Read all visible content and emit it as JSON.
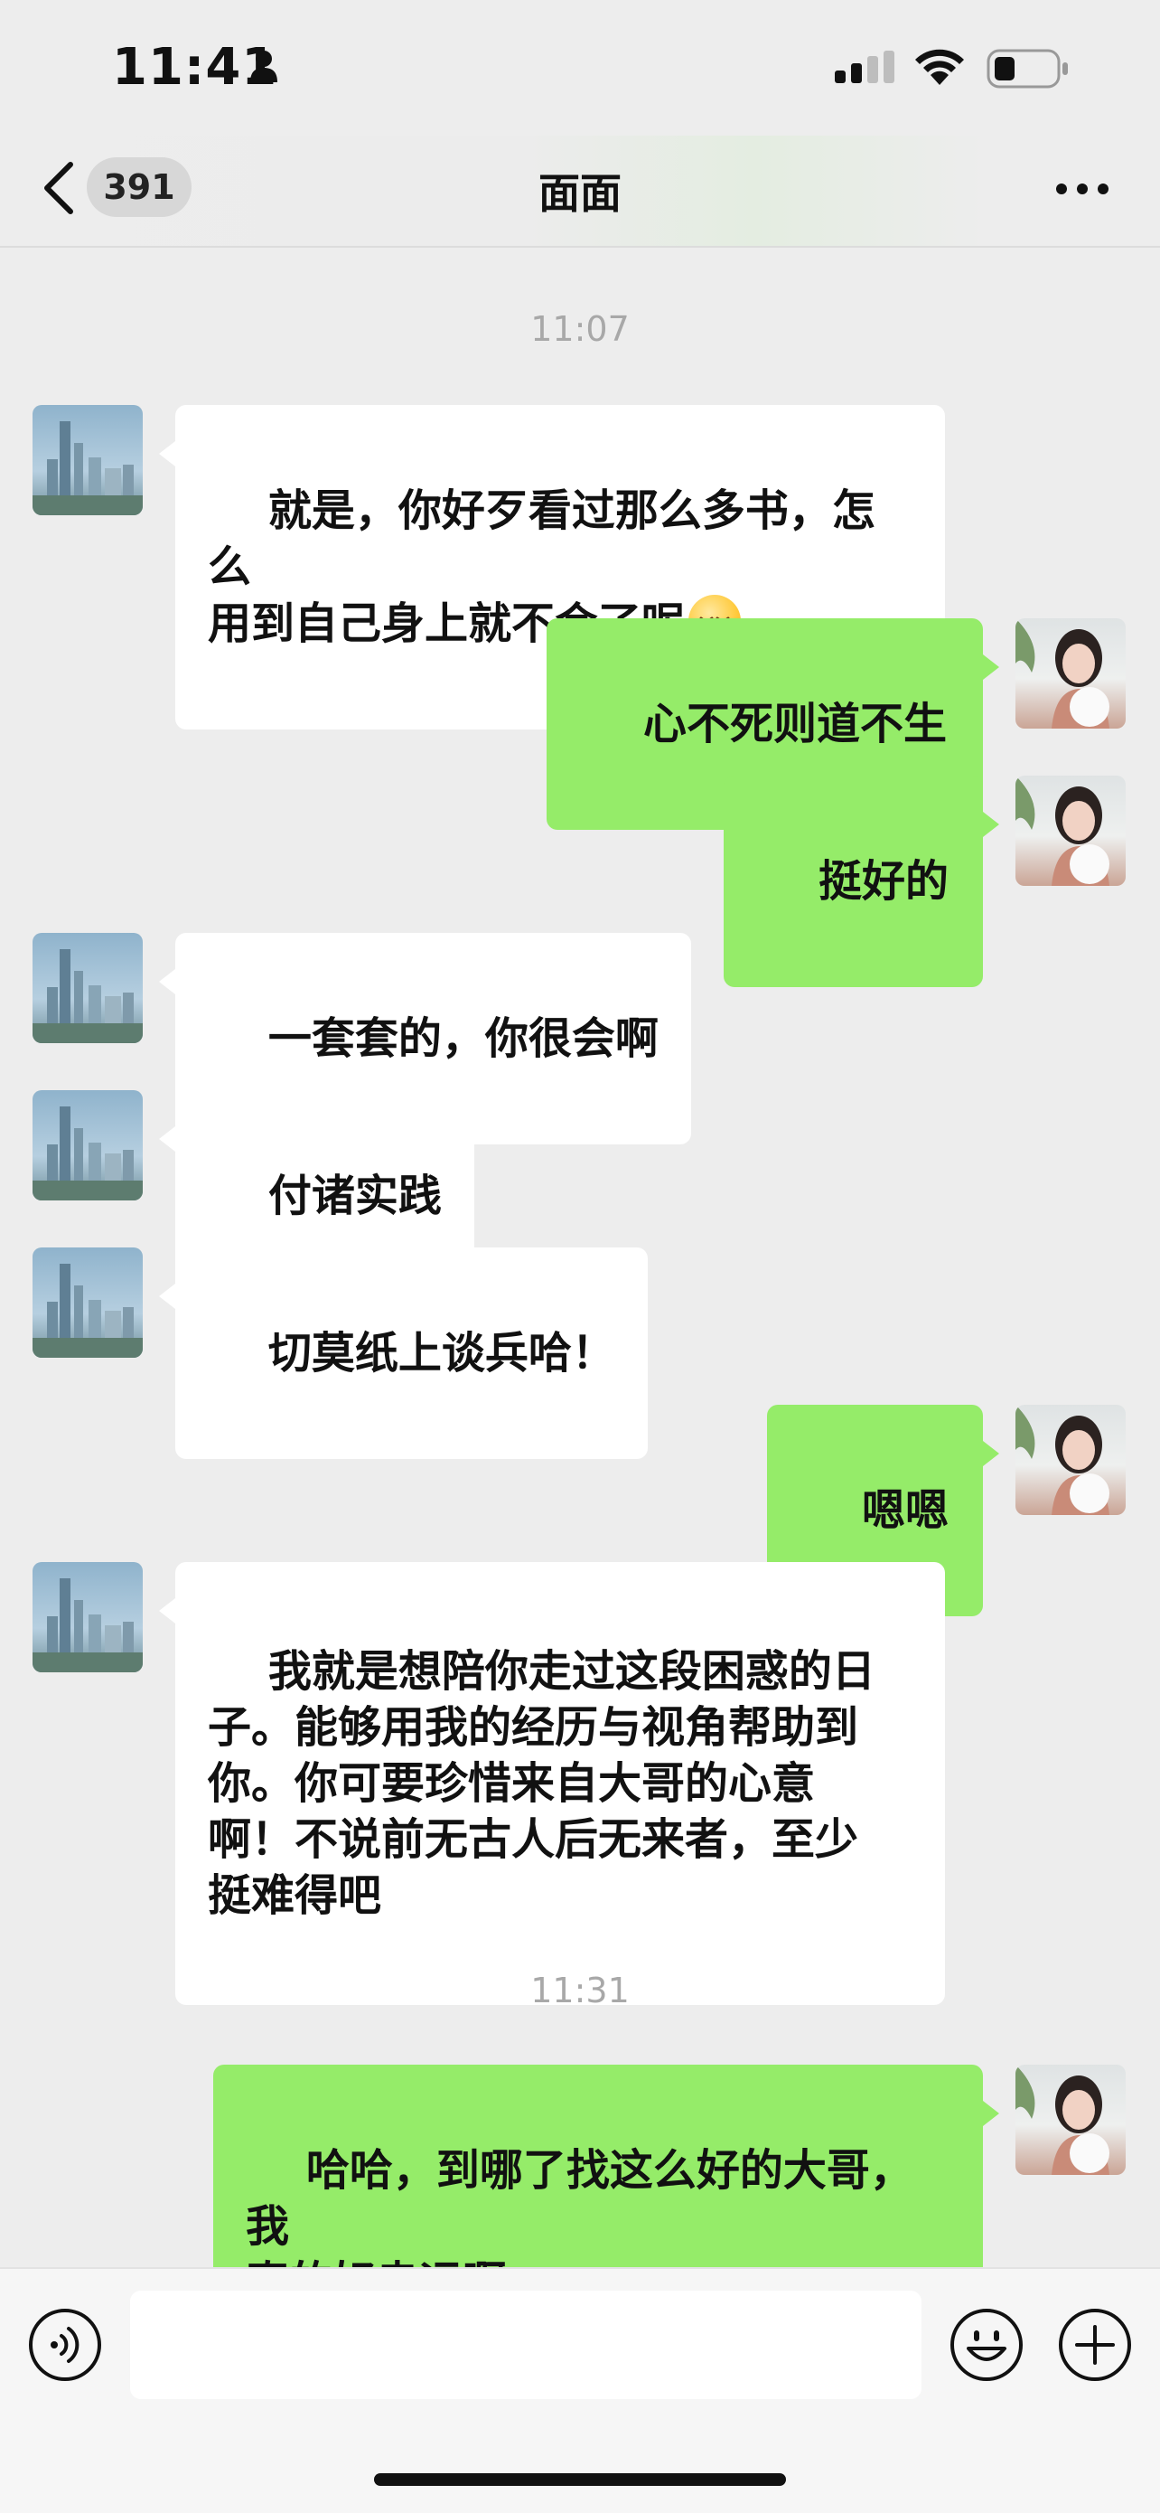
{
  "status_bar": {
    "time": "11:41"
  },
  "header": {
    "unread_count": "391",
    "title": "面面"
  },
  "messages": [
    {
      "type": "timestamp",
      "text": "11:07"
    },
    {
      "type": "message",
      "side": "left",
      "text": "就是，你好歹看过那么多书，怎么\n用到自己身上就不会了呢",
      "emoji": "relieved-face-emoji"
    },
    {
      "type": "message",
      "side": "right",
      "text": "心不死则道不生"
    },
    {
      "type": "message",
      "side": "right",
      "text": "挺好的"
    },
    {
      "type": "message",
      "side": "left",
      "text": "一套套的，你很会啊"
    },
    {
      "type": "message",
      "side": "left",
      "text": "付诸实践"
    },
    {
      "type": "message",
      "side": "left",
      "text": "切莫纸上谈兵哈！"
    },
    {
      "type": "message",
      "side": "right",
      "text": "嗯嗯"
    },
    {
      "type": "message",
      "side": "left",
      "text": "我就是想陪你走过这段困惑的日\n子。能够用我的经历与视角帮助到\n你。你可要珍惜来自大哥的心意\n啊！不说前无古人后无来者，至少\n挺难得吧"
    },
    {
      "type": "timestamp",
      "text": "11:31"
    },
    {
      "type": "message",
      "side": "right",
      "text": "哈哈，到哪了找这么好的大哥，我\n真的好幸运啊"
    }
  ],
  "input": {
    "value": ""
  },
  "colors": {
    "background": "#ededed",
    "sent_bubble": "#95ec69",
    "received_bubble": "#ffffff",
    "timestamp_text": "#a8a8a8"
  }
}
